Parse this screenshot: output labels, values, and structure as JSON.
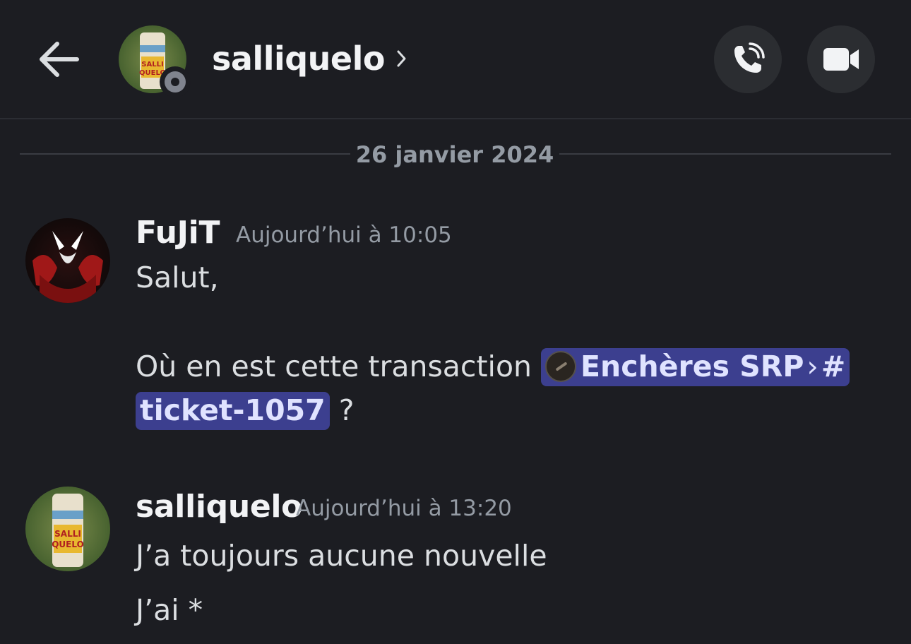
{
  "header": {
    "username": "salliquelo",
    "status": "offline"
  },
  "date_divider": "26 janvier 2024",
  "messages": [
    {
      "author": "FuJiT",
      "time": "Aujourd’hui à 10:05",
      "line1": "Salut,",
      "line2_prefix": "Où en est cette transaction ",
      "mention_server": "Enchères SRP",
      "mention_hash": "#",
      "mention_channel": "ticket-1057",
      "line3_suffix": " ?"
    },
    {
      "author": "salliquelo",
      "time": "Aujourd’hui à 13:20",
      "line1": "J’a toujours aucune nouvelle",
      "line2": "J’ai *"
    }
  ],
  "icons": {
    "back": "arrow-left-icon",
    "chevron": "chevron-right-icon",
    "call": "phone-call-icon",
    "video": "video-camera-icon"
  },
  "colors": {
    "background": "#1c1d22",
    "mention_bg": "#3c3f8f",
    "button_bg": "#2b2d31",
    "muted_text": "#949ba4"
  }
}
